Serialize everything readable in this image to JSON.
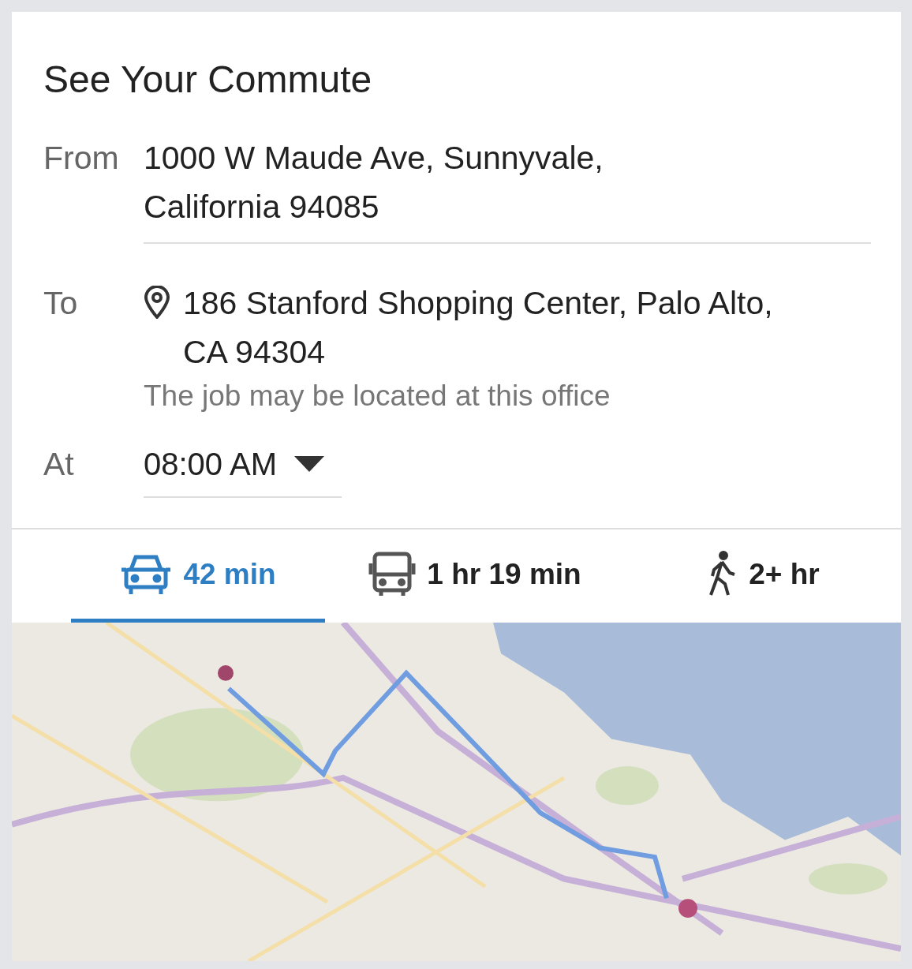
{
  "title": "See Your Commute",
  "from": {
    "label": "From",
    "value": "1000 W Maude Ave, Sunnyvale, California 94085"
  },
  "to": {
    "label": "To",
    "value": "186 Stanford Shopping Center, Palo Alto, CA 94304",
    "note": "The job may be located at this office"
  },
  "at": {
    "label": "At",
    "value": "08:00 AM"
  },
  "modes": [
    {
      "kind": "car",
      "label": "42 min",
      "selected": true
    },
    {
      "kind": "bus",
      "label": "1 hr 19 min",
      "selected": false
    },
    {
      "kind": "walk",
      "label": "2+ hr",
      "selected": false
    }
  ]
}
